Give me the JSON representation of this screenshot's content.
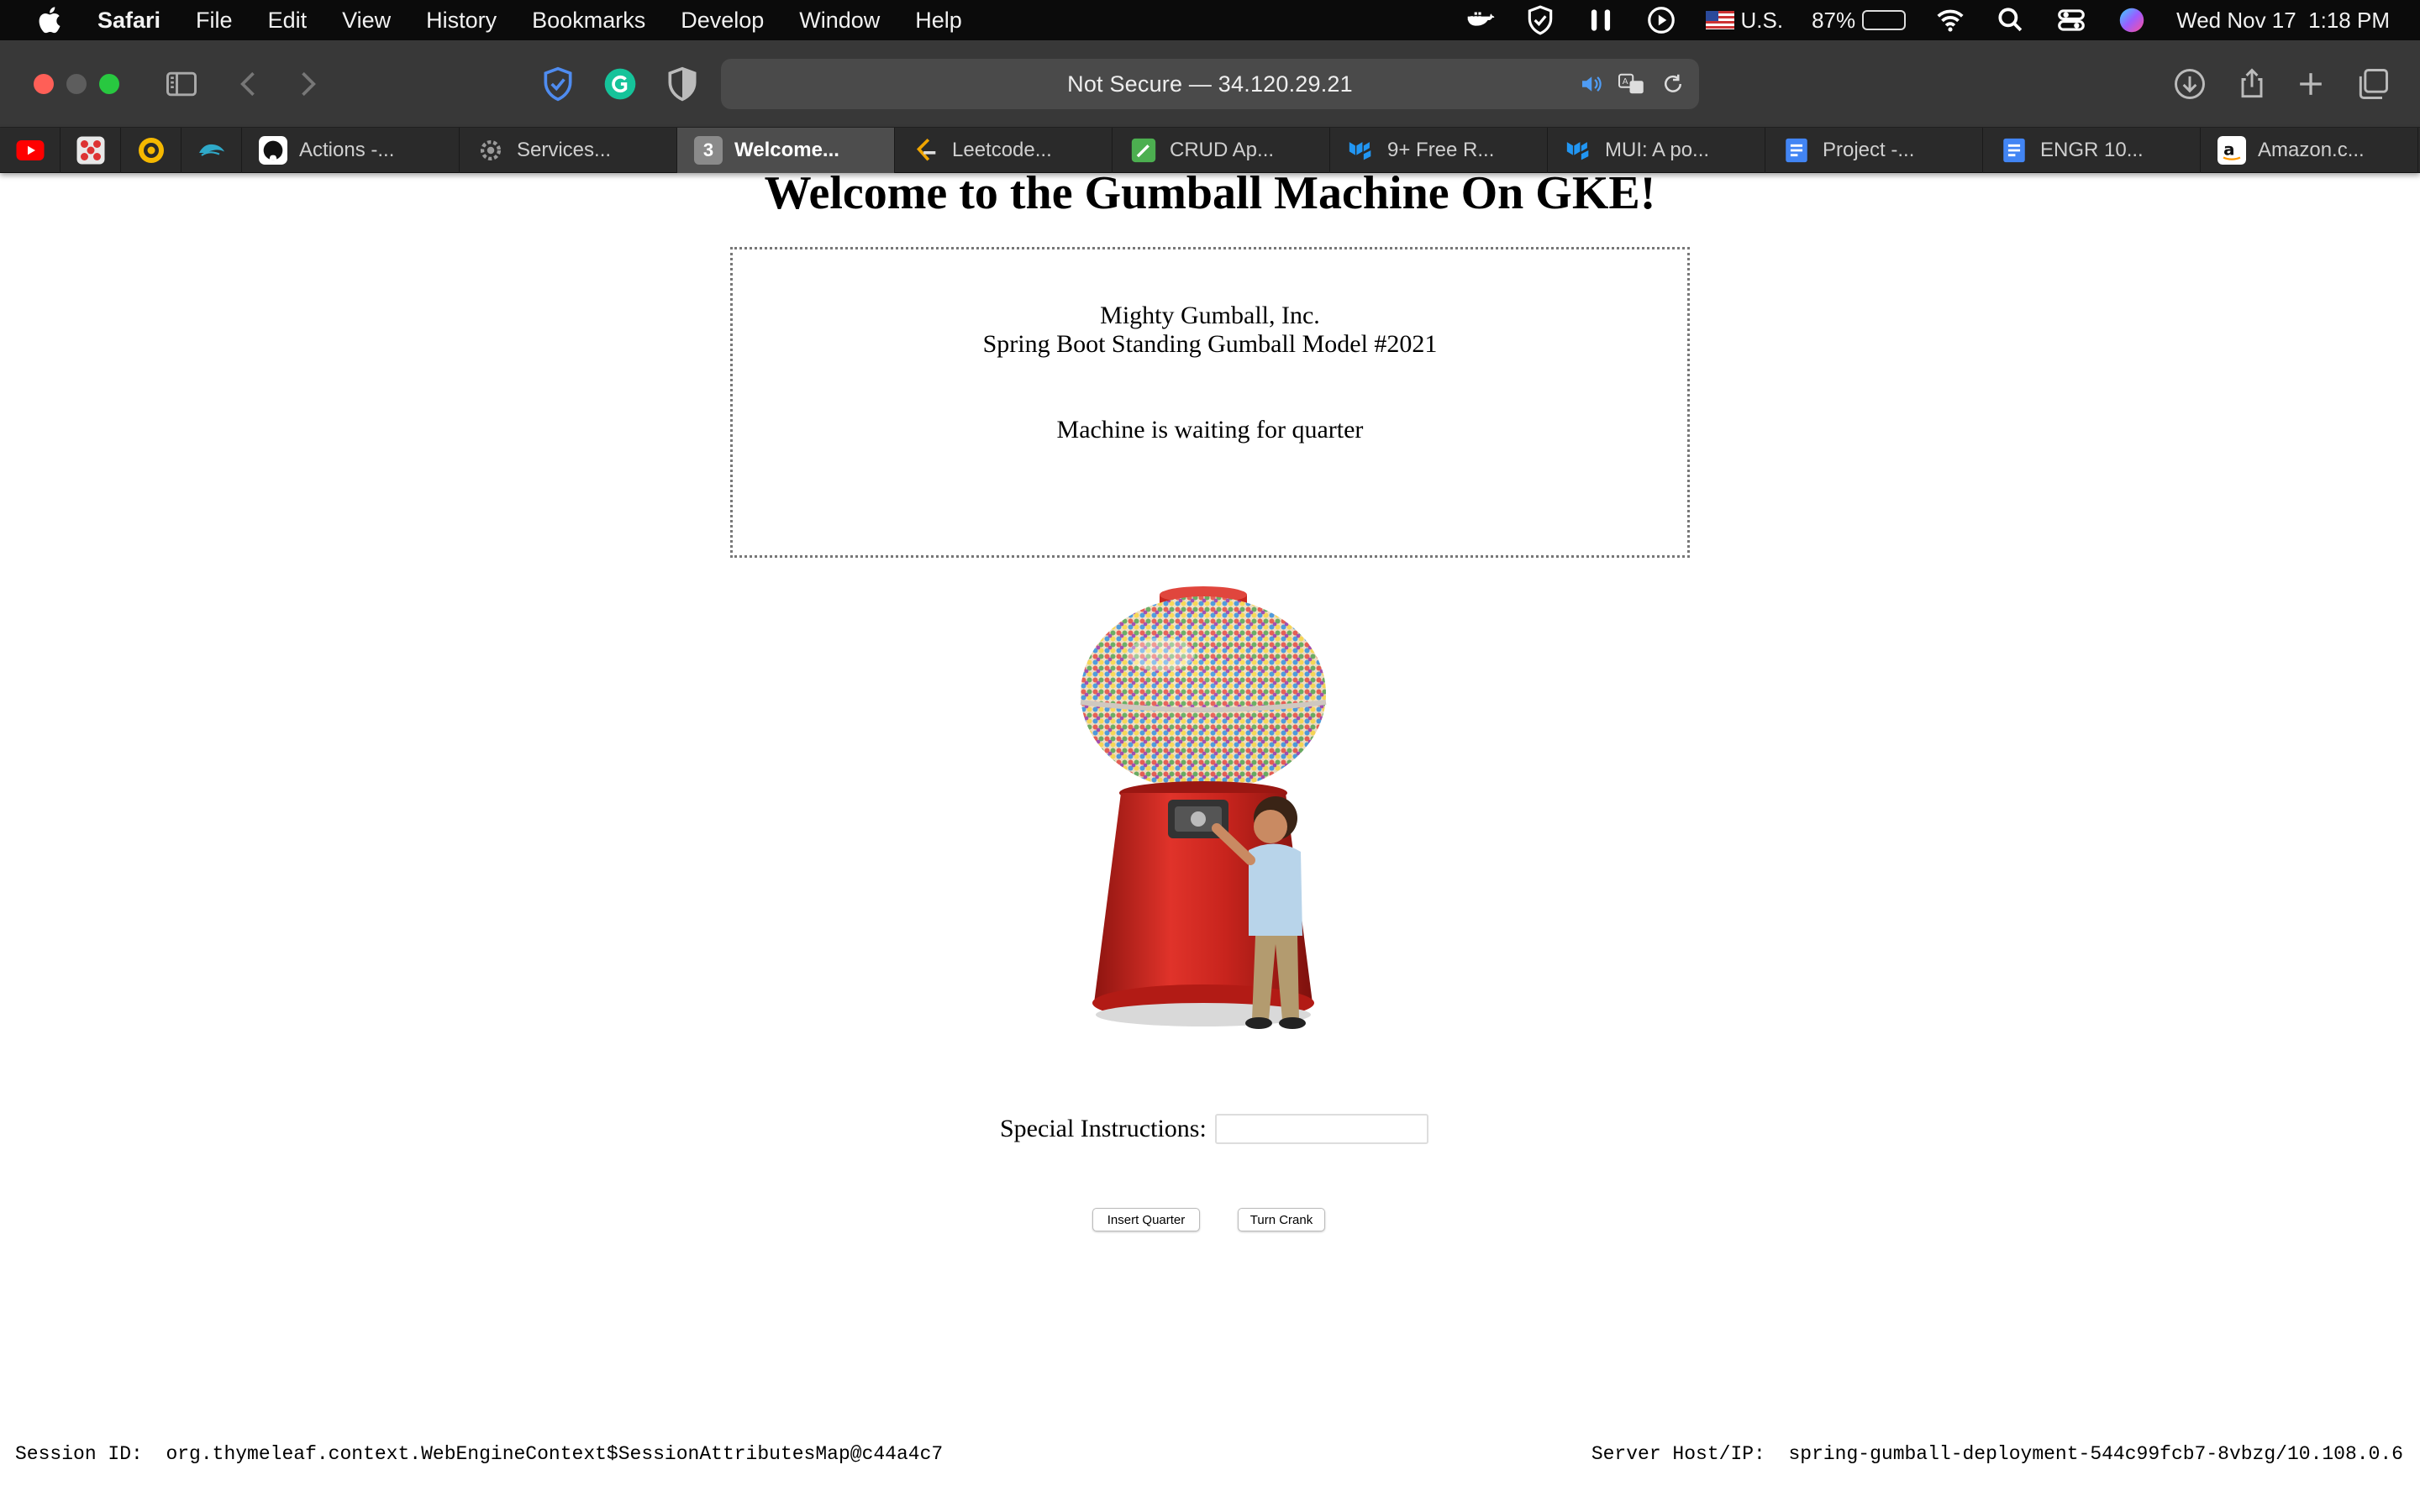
{
  "menubar": {
    "app_name": "Safari",
    "items": [
      "File",
      "Edit",
      "View",
      "History",
      "Bookmarks",
      "Develop",
      "Window",
      "Help"
    ],
    "input_source": "U.S.",
    "battery_percent": "87%",
    "battery_level": 0.87,
    "datetime": "Wed Nov 17  1:18 PM"
  },
  "toolbar": {
    "url_text": "Not Secure — 34.120.29.21"
  },
  "tabs": [
    {
      "label": "Actions -...",
      "icon": "github-icon"
    },
    {
      "label": "Services...",
      "icon": "gear-icon"
    },
    {
      "label": "Welcome...",
      "icon": "tab-number-icon",
      "badge": "3",
      "active": true
    },
    {
      "label": "Leetcode...",
      "icon": "leetcode-icon"
    },
    {
      "label": "CRUD Ap...",
      "icon": "crud-icon"
    },
    {
      "label": "9+ Free R...",
      "icon": "mui-icon"
    },
    {
      "label": "MUI: A po...",
      "icon": "mui-icon"
    },
    {
      "label": "Project -...",
      "icon": "docs-icon"
    },
    {
      "label": "ENGR 10...",
      "icon": "docs-icon"
    },
    {
      "label": "Amazon.c...",
      "icon": "amazon-icon"
    }
  ],
  "page": {
    "title": "Welcome to the Gumball Machine On GKE!",
    "company": "Mighty Gumball, Inc.",
    "model": "Spring Boot Standing Gumball Model #2021",
    "state_message": "Machine is waiting for quarter",
    "instructions_label": "Special Instructions:",
    "instructions_value": "",
    "insert_button": "Insert Quarter",
    "crank_button": "Turn Crank",
    "session_label": "Session ID:",
    "session_value": "org.thymeleaf.context.WebEngineContext$SessionAttributesMap@c44a4c7",
    "server_label": "Server Host/IP:",
    "server_value": "spring-gumball-deployment-544c99fcb7-8vbzg/10.108.0.6"
  }
}
